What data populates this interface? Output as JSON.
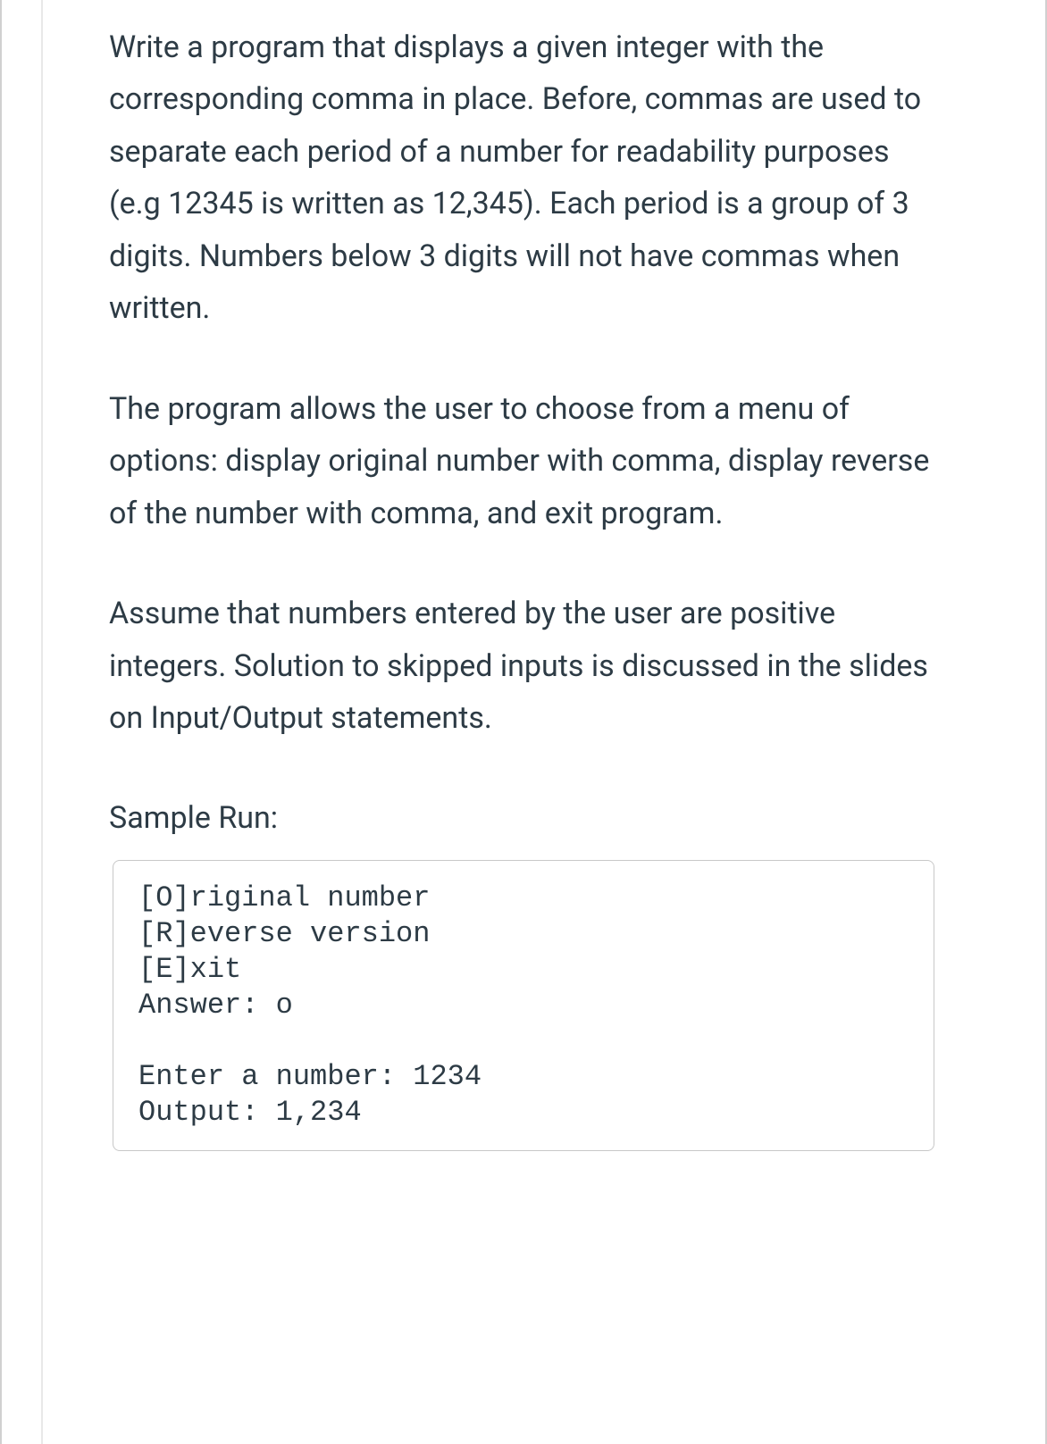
{
  "paragraphs": {
    "p1": "Write a program that displays a given integer with the corresponding comma in place. Before, commas are used to separate each period of a number for readability purposes (e.g 12345 is written as 12,345).  Each period is a group of 3 digits. Numbers below 3 digits will not have commas when written.",
    "p2": "The program allows the user to choose from a menu of options:  display original number with comma, display reverse of the number with comma, and exit program.",
    "p3": "Assume that numbers entered by the user are positive integers. Solution to skipped inputs is discussed in the slides on Input/Output statements."
  },
  "sample_run_label": "Sample Run:",
  "code_output": "[O]riginal number\n[R]everse version\n[E]xit\nAnswer: o\n\nEnter a number: 1234\nOutput: 1,234"
}
